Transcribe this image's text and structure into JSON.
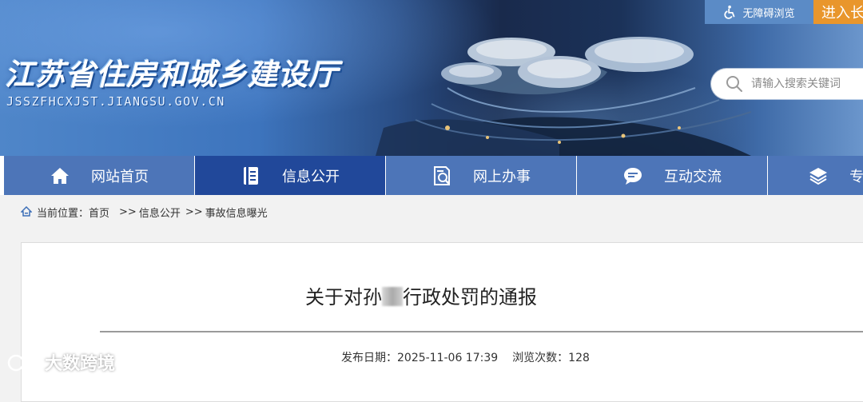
{
  "header": {
    "site_title": "江苏省住房和城乡建设厅",
    "site_url": "JSSZFHCXJST.JIANGSU.GOV.CN",
    "accessibility_label": "无障碍浏览",
    "elder_mode_label": "进入长",
    "search_placeholder": "请输入搜索关键词"
  },
  "nav": {
    "items": [
      {
        "label": "网站首页",
        "icon": "home-icon"
      },
      {
        "label": "信息公开",
        "icon": "document-list-icon",
        "active": true
      },
      {
        "label": "网上办事",
        "icon": "search-document-icon"
      },
      {
        "label": "互动交流",
        "icon": "chat-bubble-icon"
      },
      {
        "label": "专",
        "icon": "layers-icon"
      }
    ]
  },
  "breadcrumb": {
    "prefix": "当前位置：",
    "items": [
      "首页",
      "信息公开",
      "事故信息曝光"
    ],
    "separator": ">>"
  },
  "article": {
    "title_before": "关于对孙",
    "title_after": "行政处罚的通报",
    "date_label": "发布日期：",
    "date_value": "2025-11-06 17:39",
    "views_label": "浏览次数：",
    "views_value": "128"
  },
  "watermark": {
    "text": "大数跨境"
  },
  "colors": {
    "nav_bg": "#4d75b8",
    "nav_active_bg": "#21489a",
    "accessibility_bg": "#5b8bc6",
    "elder_mode_bg": "#e9962c"
  }
}
